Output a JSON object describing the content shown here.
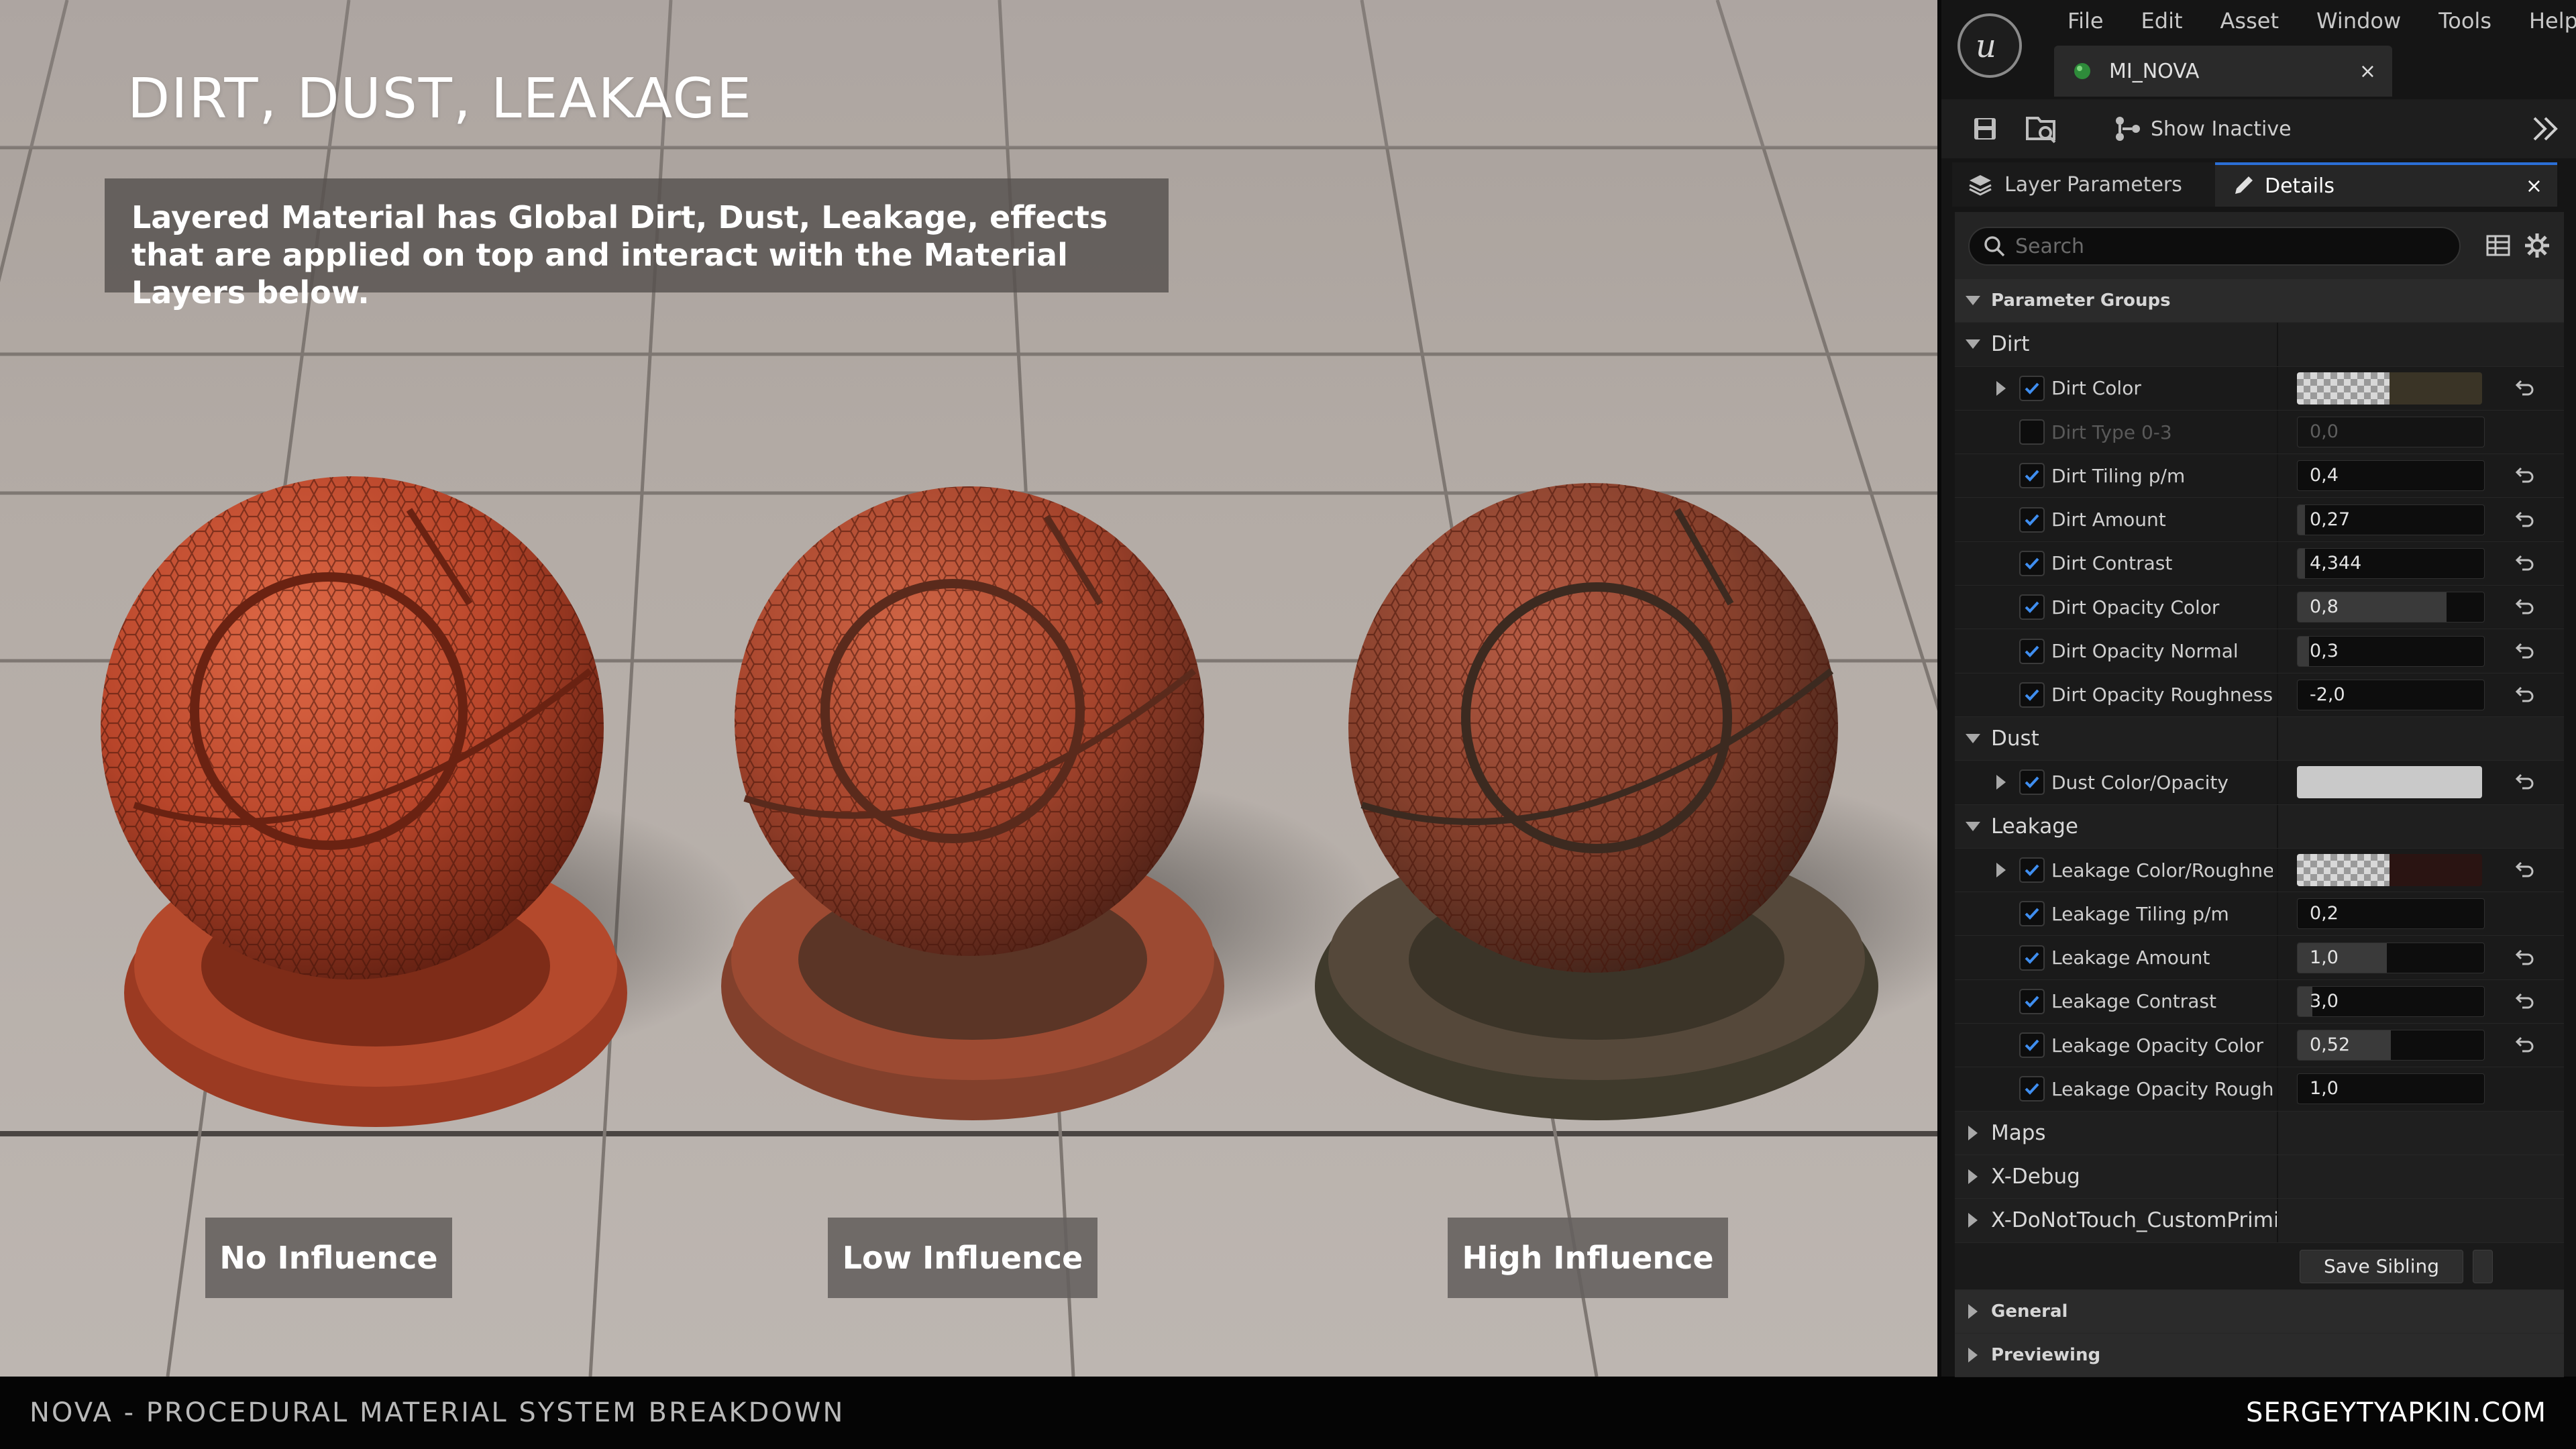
{
  "scene": {
    "title": "DIRT, DUST, LEAKAGE",
    "description": "Layered Material has Global Dirt, Dust, Leakage, effects that are applied on top and interact with the Material Layers below.",
    "labels": {
      "no": "No Influence",
      "low": "Low Influence",
      "high": "High Influence"
    }
  },
  "footer": {
    "left": "NOVA - PROCEDURAL MATERIAL SYSTEM BREAKDOWN",
    "right": "SERGEYTYAPKIN.COM"
  },
  "editor": {
    "menu": [
      "File",
      "Edit",
      "Asset",
      "Window",
      "Tools",
      "Help"
    ],
    "asset_tab": "MI_NOVA",
    "close_glyph": "×",
    "toolbar": {
      "show_inactive": "Show Inactive"
    },
    "tabs": {
      "layer_parameters": "Layer Parameters",
      "details": "Details"
    },
    "search": {
      "placeholder": "Search"
    },
    "parameter_groups": "Parameter Groups",
    "groups": {
      "dirt": "Dirt",
      "dust": "Dust",
      "leakage": "Leakage",
      "maps": "Maps",
      "xdebug": "X-Debug",
      "xdonottouch": "X-DoNotTouch_CustomPrimiti",
      "general": "General",
      "previewing": "Previewing"
    },
    "params": {
      "dirt_color": {
        "label": "Dirt Color",
        "color": "#3a3426"
      },
      "dirt_type": {
        "label": "Dirt Type 0-3",
        "value": "0,0"
      },
      "dirt_tiling": {
        "label": "Dirt Tiling p/m",
        "value": "0,4"
      },
      "dirt_amount": {
        "label": "Dirt Amount",
        "value": "0,27",
        "fraction": 0.04
      },
      "dirt_contrast": {
        "label": "Dirt Contrast",
        "value": "4,344",
        "fraction": 0.04
      },
      "dirt_opacity_color": {
        "label": "Dirt Opacity Color",
        "value": "0,8",
        "fraction": 0.8
      },
      "dirt_opacity_normal": {
        "label": "Dirt Opacity Normal",
        "value": "0,3",
        "fraction": 0.06
      },
      "dirt_opacity_roughness": {
        "label": "Dirt Opacity Roughness",
        "value": "-2,0"
      },
      "dust_color_opacity": {
        "label": "Dust Color/Opacity",
        "color": "#c9c9c9"
      },
      "leakage_color_roughness": {
        "label": "Leakage Color/Roughness",
        "color": "#2a1412"
      },
      "leakage_tiling": {
        "label": "Leakage Tiling p/m",
        "value": "0,2"
      },
      "leakage_amount": {
        "label": "Leakage Amount",
        "value": "1,0",
        "fraction": 0.48
      },
      "leakage_contrast": {
        "label": "Leakage Contrast",
        "value": "3,0",
        "fraction": 0.08
      },
      "leakage_opacity_color": {
        "label": "Leakage Opacity Color",
        "value": "0,52",
        "fraction": 0.5
      },
      "leakage_opacity_roughness": {
        "label": "Leakage Opacity Roughn...",
        "value": "1,0"
      }
    },
    "save_sibling": "Save Sibling"
  },
  "colors": {
    "accent": "#2b6fd6",
    "sphere_red": "#b8452a",
    "floor": "#b3aba5"
  }
}
